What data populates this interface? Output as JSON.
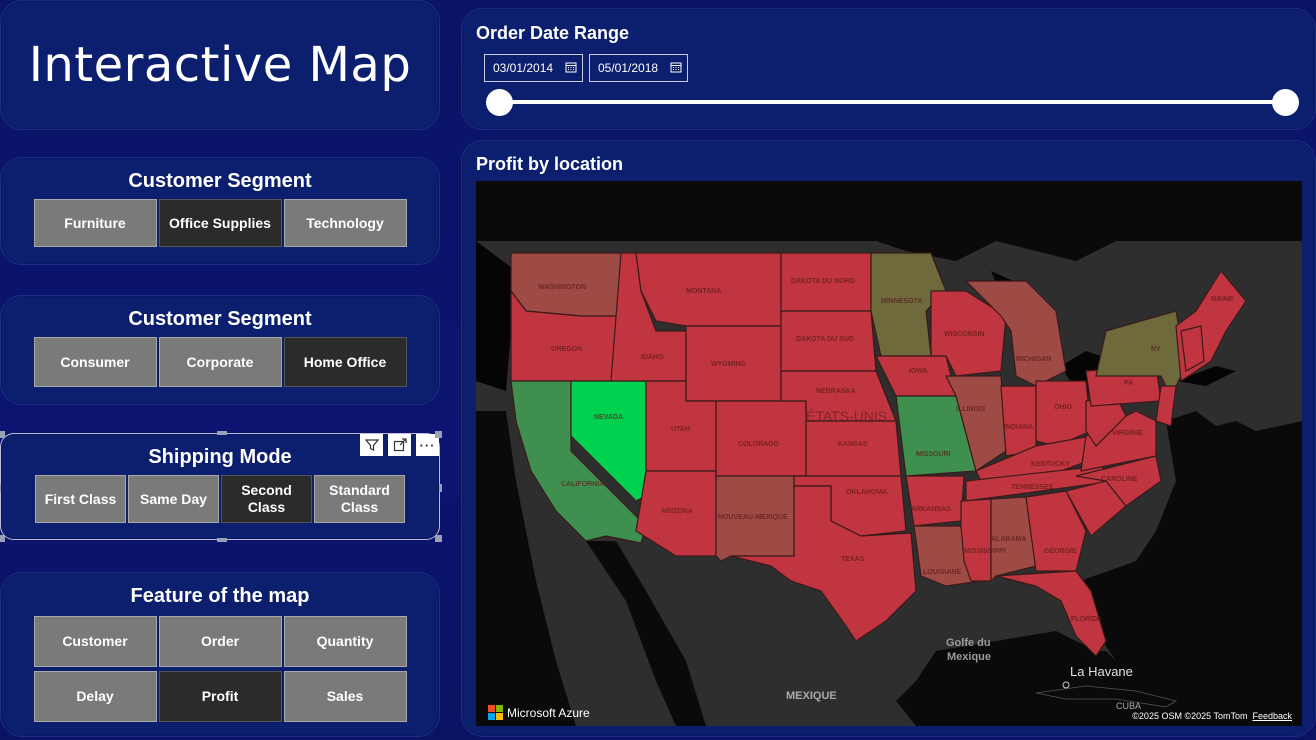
{
  "title": "Interactive Map",
  "category_slicer": {
    "title": "Customer Segment",
    "buttons": [
      "Furniture",
      "Office Supplies",
      "Technology"
    ],
    "selected": "Office Supplies"
  },
  "segment_slicer": {
    "title": "Customer Segment",
    "buttons": [
      "Consumer",
      "Corporate",
      "Home Office"
    ],
    "selected": "Home Office"
  },
  "shipping_slicer": {
    "title": "Shipping Mode",
    "buttons": [
      "First Class",
      "Same Day",
      "Second Class",
      "Standard Class"
    ],
    "selected": "Second Class",
    "toolbar": [
      "filter-icon",
      "focus-mode-icon",
      "more-options-icon"
    ]
  },
  "feature_slicer": {
    "title": "Feature of the map",
    "buttons": [
      "Customer",
      "Order",
      "Quantity",
      "Delay",
      "Profit",
      "Sales"
    ],
    "selected": "Profit"
  },
  "date_range": {
    "title": "Order Date Range",
    "start": "03/01/2014",
    "end": "05/01/2018",
    "slider_start": 0.0,
    "slider_end": 1.0
  },
  "map": {
    "title": "Profit by location",
    "provider": "Microsoft Azure",
    "copyright": "©2025 OSM  ©2025 TomTom",
    "feedback": "Feedback",
    "labels": {
      "gulf": "Golfe du Mexique",
      "havana": "La Havane",
      "cuba": "CUBA",
      "mexique": "MEXIQUE",
      "usa": "ÉTATS-UNIS"
    },
    "colors": {
      "loss_strong": "#c0353f",
      "loss_light": "#9e4a45",
      "neutral": "#6e6a3c",
      "profit": "#3f8f4f",
      "profit_strong": "#00d24f",
      "land": "#303030",
      "water": "#000000"
    }
  }
}
